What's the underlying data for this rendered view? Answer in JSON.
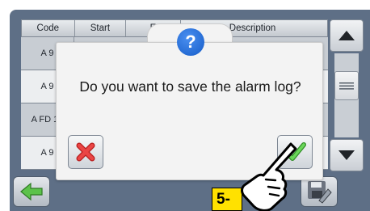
{
  "table": {
    "headers": [
      "Code",
      "Start",
      "E",
      "Description"
    ],
    "rows": [
      {
        "code": "A 9"
      },
      {
        "code": "A 9"
      },
      {
        "code": "A FD 10"
      },
      {
        "code": "A 9"
      }
    ]
  },
  "dialog": {
    "question": "Do you want to save the alarm log?",
    "icon": "question-mark-icon",
    "icon_text": "?",
    "cancel_icon": "red-x-icon",
    "confirm_icon": "green-check-icon"
  },
  "toolbar": {
    "back_icon": "green-left-arrow-icon",
    "save_icon": "save-disk-icon"
  },
  "scrollbar": {
    "up_icon": "up-arrow-icon",
    "down_icon": "down-arrow-icon"
  },
  "annotation": {
    "step_label": "5-",
    "hand_icon": "pointing-hand-icon"
  },
  "colors": {
    "screen_bg": "#5e6f86",
    "row_odd": "#c8cdd3",
    "row_even": "#eceef0",
    "dialog_bg": "#f3f3f3",
    "accent_blue": "#1a63d6",
    "cancel_red": "#e23a3a",
    "confirm_green": "#57c84a",
    "step_label_bg": "#ffe100"
  }
}
